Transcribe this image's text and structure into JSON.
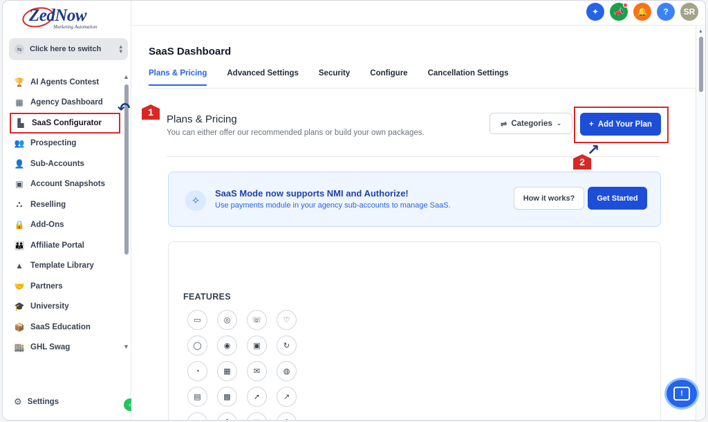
{
  "logo": {
    "brand": "ZedNow",
    "tagline": "Marketing Automation"
  },
  "switcher": {
    "label": "Click here to switch"
  },
  "nav": {
    "items": [
      {
        "label": "AI Agents Contest",
        "icon": "trophy-icon",
        "glyph": "🏆"
      },
      {
        "label": "Agency Dashboard",
        "icon": "dashboard-icon",
        "glyph": "▦"
      },
      {
        "label": "SaaS Configurator",
        "icon": "bar-chart-icon",
        "glyph": "▙"
      },
      {
        "label": "Prospecting",
        "icon": "users-icon",
        "glyph": "👥"
      },
      {
        "label": "Sub-Accounts",
        "icon": "user-icon",
        "glyph": "👤"
      },
      {
        "label": "Account Snapshots",
        "icon": "snapshot-icon",
        "glyph": "▣"
      },
      {
        "label": "Reselling",
        "icon": "network-icon",
        "glyph": "⛬"
      },
      {
        "label": "Add-Ons",
        "icon": "bag-icon",
        "glyph": "🔒"
      },
      {
        "label": "Affiliate Portal",
        "icon": "group-icon",
        "glyph": "👪"
      },
      {
        "label": "Template Library",
        "icon": "shapes-icon",
        "glyph": "▲"
      },
      {
        "label": "Partners",
        "icon": "handshake-icon",
        "glyph": "🤝"
      },
      {
        "label": "University",
        "icon": "graduation-icon",
        "glyph": "🎓"
      },
      {
        "label": "SaaS Education",
        "icon": "box-icon",
        "glyph": "📦"
      },
      {
        "label": "GHL Swag",
        "icon": "store-icon",
        "glyph": "🏬"
      }
    ],
    "settings_label": "Settings"
  },
  "topbar": {
    "avatar_initials": "SR",
    "colors": {
      "blue": "#2563eb",
      "green": "#16a34a",
      "orange": "#f97316",
      "help": "#3b82f6",
      "avatar": "#a3a38a"
    }
  },
  "page": {
    "title": "SaaS Dashboard",
    "tabs": [
      "Plans & Pricing",
      "Advanced Settings",
      "Security",
      "Configure",
      "Cancellation Settings"
    ],
    "active_tab": "Plans & Pricing"
  },
  "plans": {
    "title": "Plans & Pricing",
    "subtitle": "You can either offer our recommended plans or build your own packages.",
    "categories_label": "Categories",
    "add_plan_label": "Add Your Plan"
  },
  "banner": {
    "title": "SaaS Mode now supports NMI and Authorize!",
    "subtitle": "Use payments module in your agency sub-accounts to manage SaaS.",
    "how_label": "How it works?",
    "start_label": "Get Started"
  },
  "features": {
    "label": "FEATURES",
    "icons": [
      "chat-icon",
      "messenger-icon",
      "phone-icon",
      "bulb-icon",
      "comment-icon",
      "target-icon",
      "inbox-icon",
      "callback-icon",
      "pie-icon",
      "calendar-icon",
      "mail-icon",
      "whatsapp-icon",
      "layout-icon",
      "qr-icon",
      "cursor-icon",
      "trend-icon",
      "doc-icon",
      "grid-icon",
      "save-icon",
      "upload-icon"
    ]
  },
  "annotations": {
    "step1": "1",
    "step2": "2"
  },
  "colors": {
    "accent": "#2563eb",
    "primary_button": "#1d4ed8",
    "highlight": "#dc2626"
  }
}
